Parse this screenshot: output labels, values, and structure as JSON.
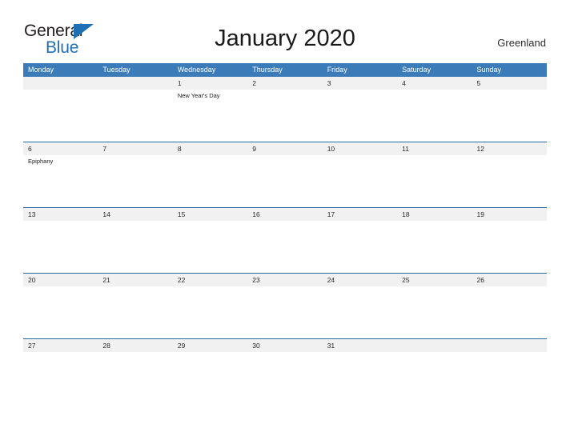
{
  "logo": {
    "word_one": "General",
    "word_two": "Blue",
    "flag_icon": "blue-triangle-flag-icon",
    "brand_color": "#1f6fb5",
    "text_color": "#231f20"
  },
  "header": {
    "title": "January 2020",
    "country": "Greenland"
  },
  "calendar": {
    "header_color": "#3b7cb8",
    "row_border_color": "#2d6a9f",
    "day_band_color": "#f1f1f1",
    "weekdays": [
      "Monday",
      "Tuesday",
      "Wednesday",
      "Thursday",
      "Friday",
      "Saturday",
      "Sunday"
    ],
    "weeks": [
      {
        "days": [
          {
            "date": "",
            "events": []
          },
          {
            "date": "",
            "events": []
          },
          {
            "date": "1",
            "events": [
              "New Year's Day"
            ]
          },
          {
            "date": "2",
            "events": []
          },
          {
            "date": "3",
            "events": []
          },
          {
            "date": "4",
            "events": []
          },
          {
            "date": "5",
            "events": []
          }
        ]
      },
      {
        "days": [
          {
            "date": "6",
            "events": [
              "Epiphany"
            ]
          },
          {
            "date": "7",
            "events": []
          },
          {
            "date": "8",
            "events": []
          },
          {
            "date": "9",
            "events": []
          },
          {
            "date": "10",
            "events": []
          },
          {
            "date": "11",
            "events": []
          },
          {
            "date": "12",
            "events": []
          }
        ]
      },
      {
        "days": [
          {
            "date": "13",
            "events": []
          },
          {
            "date": "14",
            "events": []
          },
          {
            "date": "15",
            "events": []
          },
          {
            "date": "16",
            "events": []
          },
          {
            "date": "17",
            "events": []
          },
          {
            "date": "18",
            "events": []
          },
          {
            "date": "19",
            "events": []
          }
        ]
      },
      {
        "days": [
          {
            "date": "20",
            "events": []
          },
          {
            "date": "21",
            "events": []
          },
          {
            "date": "22",
            "events": []
          },
          {
            "date": "23",
            "events": []
          },
          {
            "date": "24",
            "events": []
          },
          {
            "date": "25",
            "events": []
          },
          {
            "date": "26",
            "events": []
          }
        ]
      },
      {
        "days": [
          {
            "date": "27",
            "events": []
          },
          {
            "date": "28",
            "events": []
          },
          {
            "date": "29",
            "events": []
          },
          {
            "date": "30",
            "events": []
          },
          {
            "date": "31",
            "events": []
          },
          {
            "date": "",
            "events": []
          },
          {
            "date": "",
            "events": []
          }
        ]
      }
    ]
  }
}
